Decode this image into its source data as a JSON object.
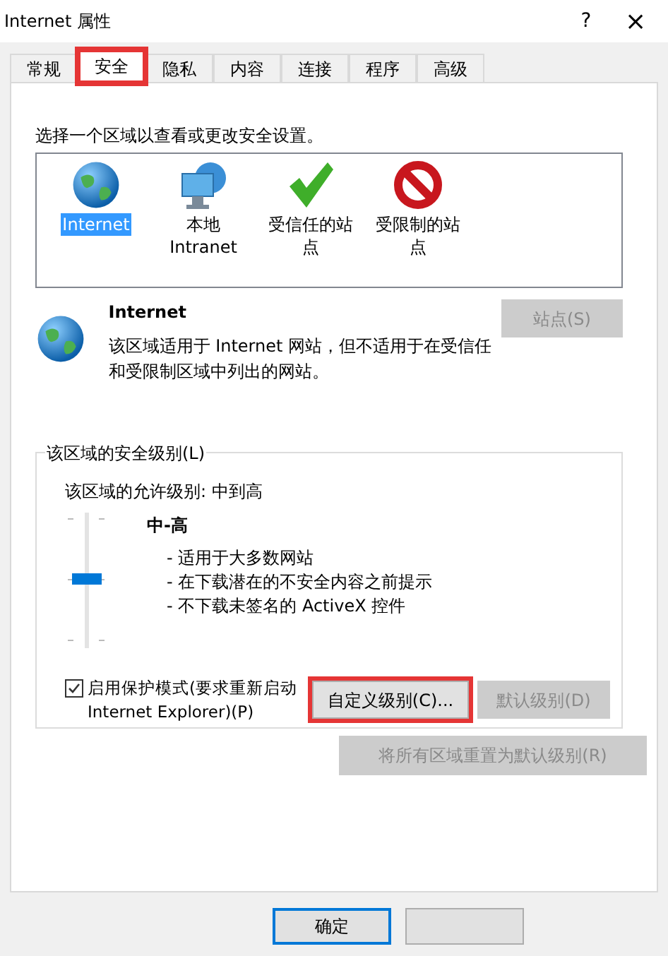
{
  "window": {
    "title": "Internet 属性",
    "help": "?",
    "close": "×"
  },
  "tabs": [
    {
      "label": "常规",
      "selected": false,
      "highlighted": false
    },
    {
      "label": "安全",
      "selected": true,
      "highlighted": true
    },
    {
      "label": "隐私",
      "selected": false,
      "highlighted": false
    },
    {
      "label": "内容",
      "selected": false,
      "highlighted": false
    },
    {
      "label": "连接",
      "selected": false,
      "highlighted": false
    },
    {
      "label": "程序",
      "selected": false,
      "highlighted": false
    },
    {
      "label": "高级",
      "selected": false,
      "highlighted": false
    }
  ],
  "zone_prompt": "选择一个区域以查看或更改安全设置。",
  "zones": [
    {
      "kind": "internet",
      "label": "Internet",
      "selected": true
    },
    {
      "kind": "intranet",
      "label": "本地 Intranet",
      "selected": false
    },
    {
      "kind": "trusted",
      "label": "受信任的站点",
      "selected": false
    },
    {
      "kind": "restricted",
      "label": "受限制的站点",
      "selected": false
    }
  ],
  "zone_info": {
    "kind": "internet",
    "title": "Internet",
    "description": "该区域适用于 Internet 网站，但不适用于在受信任和受限制区域中列出的网站。",
    "sites_button": {
      "label": "站点(S)",
      "disabled": true
    }
  },
  "security_level": {
    "legend": "该区域的安全级别(L)",
    "allowed": "该区域的允许级别: 中到高",
    "level": 0.5,
    "level_name": "中-高",
    "bullets": [
      "- 适用于大多数网站",
      "- 在下载潜在的不安全内容之前提示",
      "- 不下载未签名的 ActiveX 控件"
    ],
    "protected_mode": {
      "label": "启用保护模式(要求重新启动 Internet Explorer)(P)",
      "checked": true
    },
    "custom_button": {
      "label": "自定义级别(C)...",
      "disabled": false,
      "highlighted": true
    },
    "default_button": {
      "label": "默认级别(D)",
      "disabled": true,
      "highlighted": false
    }
  },
  "reset_button": {
    "label": "将所有区域重置为默认级别(R)",
    "disabled": true
  },
  "footer_buttons": [
    {
      "label": "确定",
      "default": true
    }
  ]
}
